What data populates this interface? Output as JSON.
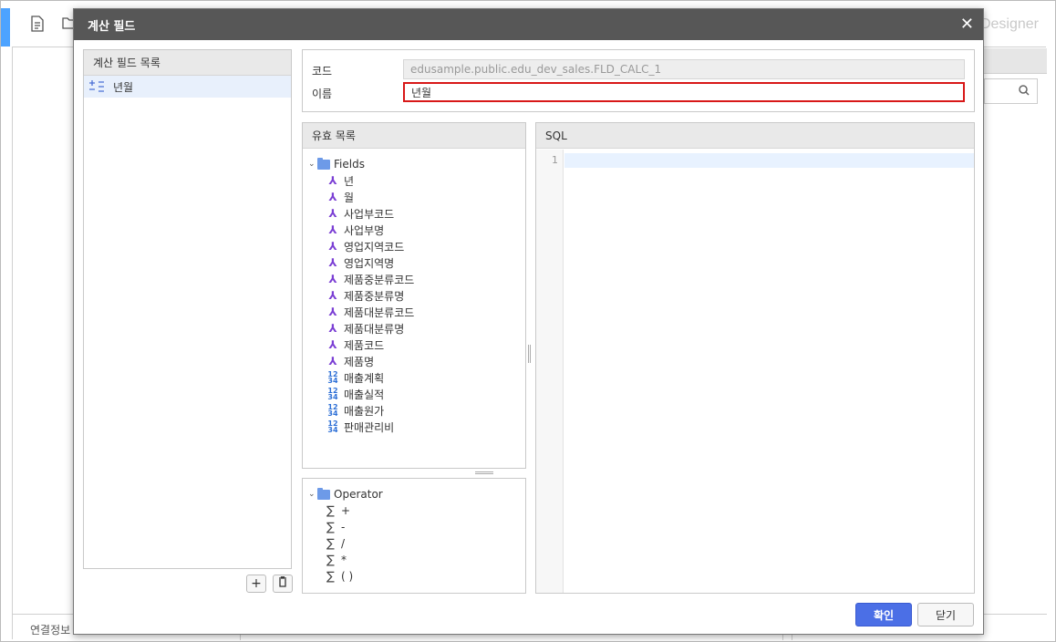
{
  "background": {
    "designer_label": "Designer",
    "bottom_label": "연결정보"
  },
  "dialog": {
    "title": "계산 필드",
    "calc_list": {
      "header": "계산 필드 목록",
      "items": [
        {
          "label": "년월"
        }
      ]
    },
    "info": {
      "code_label": "코드",
      "code_value": "edusample.public.edu_dev_sales.FLD_CALC_1",
      "name_label": "이름",
      "name_value": "년월"
    },
    "fields_panel": {
      "header": "유효 목록",
      "folder": "Fields",
      "dimensions": [
        "년",
        "월",
        "사업부코드",
        "사업부명",
        "영업지역코드",
        "영업지역명",
        "제품중분류코드",
        "제품중분류명",
        "제품대분류코드",
        "제품대분류명",
        "제품코드",
        "제품명"
      ],
      "measures": [
        "매출계획",
        "매출실적",
        "매출원가",
        "판매관리비"
      ]
    },
    "operators_panel": {
      "folder": "Operator",
      "items": [
        "+",
        "-",
        "/",
        "*",
        "( )"
      ]
    },
    "sql": {
      "header": "SQL",
      "line_number": "1"
    },
    "buttons": {
      "confirm": "확인",
      "close": "닫기"
    }
  }
}
